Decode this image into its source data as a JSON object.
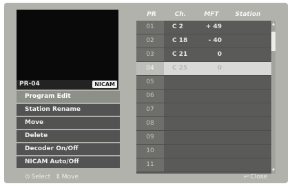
{
  "preview": {
    "channel_label": "PR-04",
    "audio_badge": "NICAM"
  },
  "menu": {
    "items": [
      {
        "label": "Program Edit",
        "selected": true
      },
      {
        "label": "Station Rename",
        "selected": false
      },
      {
        "label": "Move",
        "selected": false
      },
      {
        "label": "Delete",
        "selected": false
      },
      {
        "label": "Decoder On/Off",
        "selected": false
      },
      {
        "label": "NICAM Auto/Off",
        "selected": false
      }
    ]
  },
  "table": {
    "headers": {
      "pr": "PR",
      "ch": "Ch.",
      "mft": "MFT",
      "station": "Station"
    },
    "rows": [
      {
        "pr": "01",
        "ch": "C 2",
        "mft": "+ 49"
      },
      {
        "pr": "02",
        "ch": "C 18",
        "mft": "- 40"
      },
      {
        "pr": "03",
        "ch": "C 21",
        "mft": "0"
      },
      {
        "pr": "04",
        "ch": "C 25",
        "mft": "0",
        "highlight": true
      },
      {
        "pr": "05",
        "ch": "",
        "mft": ""
      },
      {
        "pr": "06",
        "ch": "",
        "mft": ""
      },
      {
        "pr": "07",
        "ch": "",
        "mft": ""
      },
      {
        "pr": "08",
        "ch": "",
        "mft": ""
      },
      {
        "pr": "09",
        "ch": "",
        "mft": ""
      },
      {
        "pr": "10",
        "ch": "",
        "mft": ""
      },
      {
        "pr": "11",
        "ch": "",
        "mft": ""
      }
    ]
  },
  "footer": {
    "select_label": "Select",
    "move_label": "Move",
    "close_label": "Close"
  },
  "icons": {
    "select": "enter-circle-icon",
    "move": "up-down-arrows-icon",
    "close": "return-icon"
  }
}
